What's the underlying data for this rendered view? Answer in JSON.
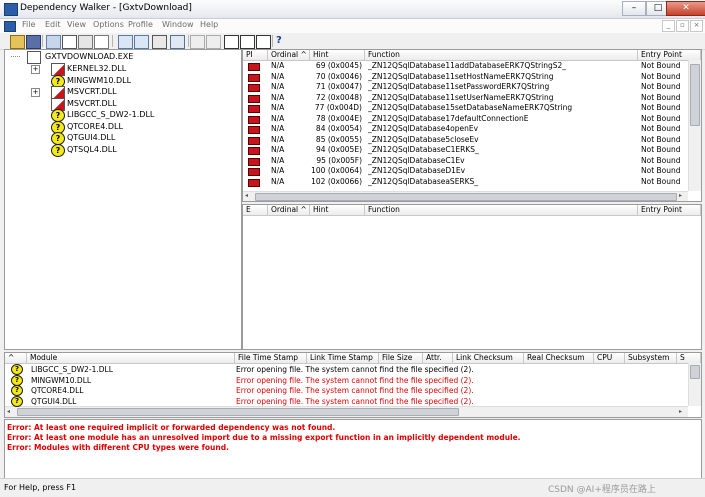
{
  "window": {
    "title": "Dependency Walker - [GxtvDownload]",
    "min": "–",
    "max": "□",
    "close": "✕"
  },
  "menu": [
    "File",
    "Edit",
    "View",
    "Options",
    "Profile",
    "Window",
    "Help"
  ],
  "mdi_controls": [
    "_",
    "▫",
    "×"
  ],
  "tree": {
    "root": "GXTVDOWNLOAD.EXE",
    "items": [
      {
        "name": "KERNEL32.DLL",
        "icon": "module-error-icon",
        "expander": "+"
      },
      {
        "name": "MINGWM10.DLL",
        "icon": "missing-module-icon",
        "expander": ""
      },
      {
        "name": "MSVCRT.DLL",
        "icon": "module-error-icon",
        "expander": "+"
      },
      {
        "name": "MSVCRT.DLL",
        "icon": "module-error-icon",
        "expander": ""
      },
      {
        "name": "LIBGCC_S_DW2-1.DLL",
        "icon": "missing-module-icon",
        "expander": ""
      },
      {
        "name": "QTCORE4.DLL",
        "icon": "missing-module-icon",
        "expander": ""
      },
      {
        "name": "QTGUI4.DLL",
        "icon": "missing-module-icon",
        "expander": ""
      },
      {
        "name": "QTSQL4.DLL",
        "icon": "missing-module-icon",
        "expander": ""
      }
    ]
  },
  "imports": {
    "headers": [
      "PI",
      "Ordinal ^",
      "Hint",
      "Function",
      "Entry Point"
    ],
    "rows": [
      {
        "ordinal": "N/A",
        "hint": "69 (0x0045)",
        "function": "_ZN12QSqlDatabase11addDatabaseERK7QStringS2_",
        "entry": "Not Bound"
      },
      {
        "ordinal": "N/A",
        "hint": "70 (0x0046)",
        "function": "_ZN12QSqlDatabase11setHostNameERK7QString",
        "entry": "Not Bound"
      },
      {
        "ordinal": "N/A",
        "hint": "71 (0x0047)",
        "function": "_ZN12QSqlDatabase11setPasswordERK7QString",
        "entry": "Not Bound"
      },
      {
        "ordinal": "N/A",
        "hint": "72 (0x0048)",
        "function": "_ZN12QSqlDatabase11setUserNameERK7QString",
        "entry": "Not Bound"
      },
      {
        "ordinal": "N/A",
        "hint": "77 (0x004D)",
        "function": "_ZN12QSqlDatabase15setDatabaseNameERK7QString",
        "entry": "Not Bound"
      },
      {
        "ordinal": "N/A",
        "hint": "78 (0x004E)",
        "function": "_ZN12QSqlDatabase17defaultConnectionE",
        "entry": "Not Bound"
      },
      {
        "ordinal": "N/A",
        "hint": "84 (0x0054)",
        "function": "_ZN12QSqlDatabase4openEv",
        "entry": "Not Bound"
      },
      {
        "ordinal": "N/A",
        "hint": "85 (0x0055)",
        "function": "_ZN12QSqlDatabase5closeEv",
        "entry": "Not Bound"
      },
      {
        "ordinal": "N/A",
        "hint": "94 (0x005E)",
        "function": "_ZN12QSqlDatabaseC1ERKS_",
        "entry": "Not Bound"
      },
      {
        "ordinal": "N/A",
        "hint": "95 (0x005F)",
        "function": "_ZN12QSqlDatabaseC1Ev",
        "entry": "Not Bound"
      },
      {
        "ordinal": "N/A",
        "hint": "100 (0x0064)",
        "function": "_ZN12QSqlDatabaseD1Ev",
        "entry": "Not Bound"
      },
      {
        "ordinal": "N/A",
        "hint": "102 (0x0066)",
        "function": "_ZN12QSqlDatabaseaSERKS_",
        "entry": "Not Bound"
      }
    ]
  },
  "exports": {
    "headers": [
      "E",
      "Ordinal ^",
      "Hint",
      "Function",
      "Entry Point"
    ]
  },
  "modules": {
    "headers": [
      "^",
      "Module",
      "File Time Stamp",
      "Link Time Stamp",
      "File Size",
      "Attr.",
      "Link Checksum",
      "Real Checksum",
      "CPU",
      "Subsystem",
      "S"
    ],
    "rows": [
      {
        "name": "LIBGCC_S_DW2-1.DLL",
        "msg": "Error opening file. The system cannot find the file specified (2).",
        "msg_color": "#000000"
      },
      {
        "name": "MINGWM10.DLL",
        "msg": "Error opening file. The system cannot find the file specified (2).",
        "msg_color": "#e10000"
      },
      {
        "name": "QTCORE4.DLL",
        "msg": "Error opening file. The system cannot find the file specified (2).",
        "msg_color": "#e10000"
      },
      {
        "name": "QTGUI4.DLL",
        "msg": "Error opening file. The system cannot find the file specified (2).",
        "msg_color": "#e10000"
      }
    ]
  },
  "log": [
    "Error: At least one required implicit or forwarded dependency was not found.",
    "Error: At least one module has an unresolved import due to a missing export function in an implicitly dependent module.",
    "Error: Modules with different CPU types were found."
  ],
  "status": {
    "text": "For Help, press F1",
    "watermark": "CSDN @AI+程序员在路上"
  }
}
